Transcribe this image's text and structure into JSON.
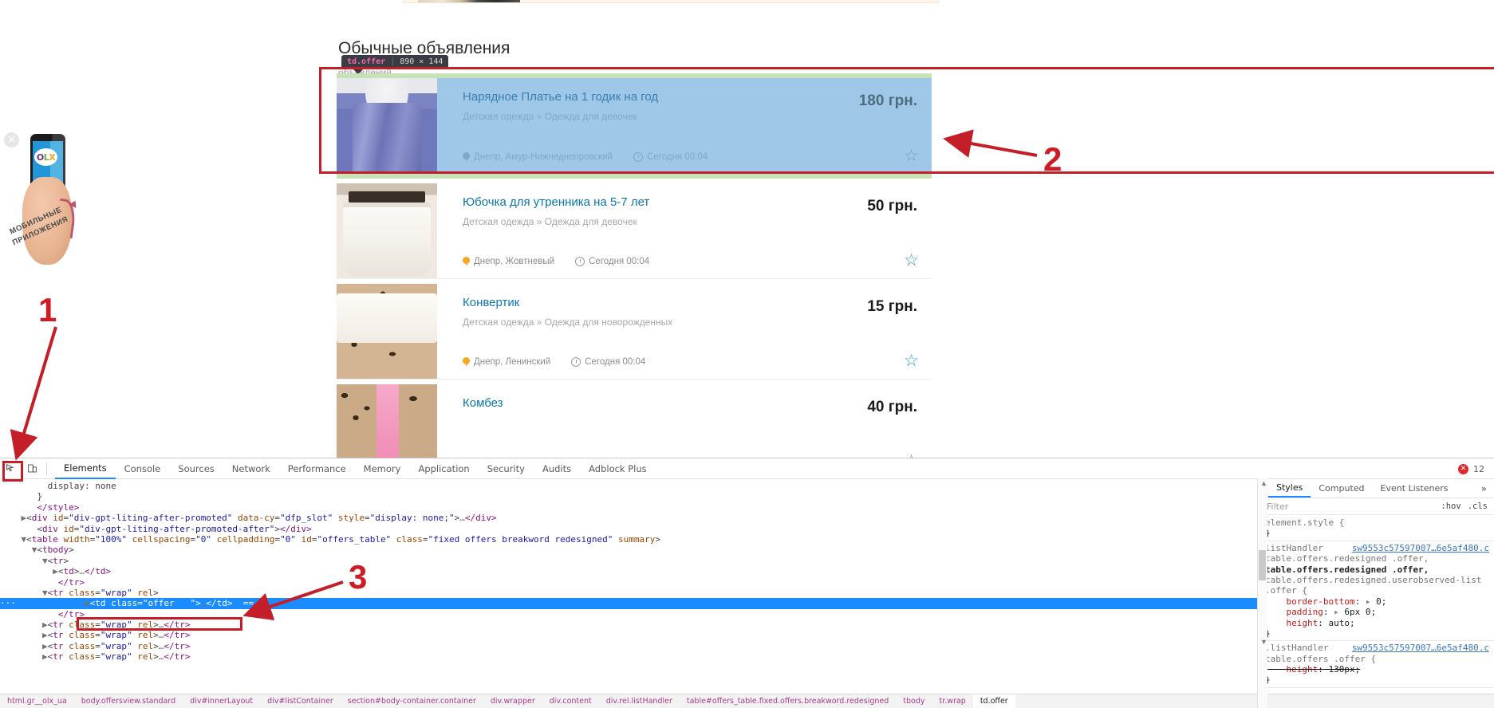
{
  "page": {
    "section_title": "Обычные объявления",
    "section_subtitle": "объявлений",
    "inspect_tooltip": {
      "selector": "td.offer",
      "dimensions": "890 × 144"
    },
    "ad": {
      "close_label": "×",
      "logo_o": "O",
      "logo_l": "L",
      "logo_x": "X",
      "caption": "МОБИЛЬНЫЕ ПРИЛОЖЕНИЯ"
    },
    "listings": [
      {
        "title": "Нарядное Платье на 1 годик на год",
        "category": "Детская одежда » Одежда для девочек",
        "location": "Днепр, Амур-Нижнеднепровский",
        "time": "Сегодня 00:04",
        "price": "180 грн.",
        "star": "☆",
        "highlighted": true
      },
      {
        "title": "Юбочка для утренника на 5-7 лет",
        "category": "Детская одежда » Одежда для девочек",
        "location": "Днепр, Жовтневый",
        "time": "Сегодня 00:04",
        "price": "50 грн.",
        "star": "☆",
        "highlighted": false
      },
      {
        "title": "Конвертик",
        "category": "Детская одежда » Одежда для новорожденных",
        "location": "Днепр, Ленинский",
        "time": "Сегодня 00:04",
        "price": "15 грн.",
        "star": "☆",
        "highlighted": false
      },
      {
        "title": "Комбез",
        "category": "",
        "location": "",
        "time": "",
        "price": "40 грн.",
        "star": "☆",
        "highlighted": false
      }
    ],
    "annotations": [
      {
        "label": "1"
      },
      {
        "label": "2"
      },
      {
        "label": "3"
      }
    ]
  },
  "devtools": {
    "tabs": [
      "Elements",
      "Console",
      "Sources",
      "Network",
      "Performance",
      "Memory",
      "Application",
      "Security",
      "Audits",
      "Adblock Plus"
    ],
    "active_tab": "Elements",
    "error_count": "12",
    "error_glyph": "✕",
    "inspect_icon": "⬚",
    "device_icon": "▯",
    "tree": [
      {
        "indent": 4,
        "parts": [
          {
            "t": "display: none",
            "c": "punc"
          }
        ]
      },
      {
        "indent": 3,
        "parts": [
          {
            "t": "}",
            "c": "punc"
          }
        ]
      },
      {
        "indent": 3,
        "parts": [
          {
            "t": "</style>",
            "c": "tag"
          }
        ]
      },
      {
        "indent": 2,
        "arrow": "▶",
        "parts": [
          {
            "t": "<",
            "c": "punc"
          },
          {
            "t": "div",
            "c": "tag"
          },
          {
            "t": " id",
            "c": "attr"
          },
          {
            "t": "=",
            "c": "punc"
          },
          {
            "t": "\"div-gpt-liting-after-promoted\"",
            "c": "val"
          },
          {
            "t": " data-cy",
            "c": "attr"
          },
          {
            "t": "=",
            "c": "punc"
          },
          {
            "t": "\"dfp_slot\"",
            "c": "val"
          },
          {
            "t": " style",
            "c": "attr"
          },
          {
            "t": "=",
            "c": "punc"
          },
          {
            "t": "\"display: none;\"",
            "c": "val"
          },
          {
            "t": ">",
            "c": "punc"
          },
          {
            "t": "…",
            "c": "ellip"
          },
          {
            "t": "</div>",
            "c": "tag"
          }
        ]
      },
      {
        "indent": 3,
        "parts": [
          {
            "t": "<",
            "c": "punc"
          },
          {
            "t": "div",
            "c": "tag"
          },
          {
            "t": " id",
            "c": "attr"
          },
          {
            "t": "=",
            "c": "punc"
          },
          {
            "t": "\"div-gpt-liting-after-promoted-after\"",
            "c": "val"
          },
          {
            "t": ">",
            "c": "punc"
          },
          {
            "t": "</div>",
            "c": "tag"
          }
        ]
      },
      {
        "indent": 2,
        "arrow": "▼",
        "parts": [
          {
            "t": "<",
            "c": "punc"
          },
          {
            "t": "table",
            "c": "tag"
          },
          {
            "t": " width",
            "c": "attr"
          },
          {
            "t": "=",
            "c": "punc"
          },
          {
            "t": "\"100%\"",
            "c": "val"
          },
          {
            "t": " cellspacing",
            "c": "attr"
          },
          {
            "t": "=",
            "c": "punc"
          },
          {
            "t": "\"0\"",
            "c": "val"
          },
          {
            "t": " cellpadding",
            "c": "attr"
          },
          {
            "t": "=",
            "c": "punc"
          },
          {
            "t": "\"0\"",
            "c": "val"
          },
          {
            "t": " id",
            "c": "attr"
          },
          {
            "t": "=",
            "c": "punc"
          },
          {
            "t": "\"offers_table\"",
            "c": "val"
          },
          {
            "t": " class",
            "c": "attr"
          },
          {
            "t": "=",
            "c": "punc"
          },
          {
            "t": "\"fixed offers breakword redesigned\"",
            "c": "val"
          },
          {
            "t": " summary",
            "c": "attr"
          },
          {
            "t": ">",
            "c": "punc"
          }
        ]
      },
      {
        "indent": 3,
        "arrow": "▼",
        "parts": [
          {
            "t": "<",
            "c": "punc"
          },
          {
            "t": "tbody",
            "c": "tag"
          },
          {
            "t": ">",
            "c": "punc"
          }
        ]
      },
      {
        "indent": 4,
        "arrow": "▼",
        "parts": [
          {
            "t": "<",
            "c": "punc"
          },
          {
            "t": "tr",
            "c": "tag"
          },
          {
            "t": ">",
            "c": "punc"
          }
        ]
      },
      {
        "indent": 5,
        "arrow": "▶",
        "parts": [
          {
            "t": "<",
            "c": "punc"
          },
          {
            "t": "td",
            "c": "tag"
          },
          {
            "t": ">",
            "c": "punc"
          },
          {
            "t": "…",
            "c": "ellip"
          },
          {
            "t": "</td>",
            "c": "tag"
          }
        ]
      },
      {
        "indent": 5,
        "parts": [
          {
            "t": "</tr>",
            "c": "tag"
          }
        ]
      },
      {
        "indent": 4,
        "arrow": "▼",
        "parts": [
          {
            "t": "<",
            "c": "punc"
          },
          {
            "t": "tr",
            "c": "tag"
          },
          {
            "t": " class",
            "c": "attr"
          },
          {
            "t": "=",
            "c": "punc"
          },
          {
            "t": "\"wrap\"",
            "c": "val"
          },
          {
            "t": " rel",
            "c": "attr"
          },
          {
            "t": ">",
            "c": "punc"
          }
        ]
      },
      {
        "indent": 5,
        "selected": true,
        "arrow": "▶",
        "parts": [
          {
            "t": "<",
            "c": "punc"
          },
          {
            "t": "td",
            "c": "tag"
          },
          {
            "t": " class",
            "c": "attr"
          },
          {
            "t": "=",
            "c": "punc"
          },
          {
            "t": "\"offer   \"",
            "c": "val"
          },
          {
            "t": ">",
            "c": "punc"
          },
          {
            "t": "…",
            "c": "ellip"
          },
          {
            "t": "</td>",
            "c": "tag"
          },
          {
            "t": "  == ",
            "c": "punc"
          },
          {
            "t": "$0",
            "c": "dollar"
          }
        ]
      },
      {
        "indent": 5,
        "parts": [
          {
            "t": "</tr>",
            "c": "tag"
          }
        ]
      },
      {
        "indent": 4,
        "arrow": "▶",
        "parts": [
          {
            "t": "<",
            "c": "punc"
          },
          {
            "t": "tr",
            "c": "tag"
          },
          {
            "t": " class",
            "c": "attr"
          },
          {
            "t": "=",
            "c": "punc"
          },
          {
            "t": "\"wrap\"",
            "c": "val"
          },
          {
            "t": " rel",
            "c": "attr"
          },
          {
            "t": ">",
            "c": "punc"
          },
          {
            "t": "…",
            "c": "ellip"
          },
          {
            "t": "</tr>",
            "c": "tag"
          }
        ]
      },
      {
        "indent": 4,
        "arrow": "▶",
        "parts": [
          {
            "t": "<",
            "c": "punc"
          },
          {
            "t": "tr",
            "c": "tag"
          },
          {
            "t": " class",
            "c": "attr"
          },
          {
            "t": "=",
            "c": "punc"
          },
          {
            "t": "\"wrap\"",
            "c": "val"
          },
          {
            "t": " rel",
            "c": "attr"
          },
          {
            "t": ">",
            "c": "punc"
          },
          {
            "t": "…",
            "c": "ellip"
          },
          {
            "t": "</tr>",
            "c": "tag"
          }
        ]
      },
      {
        "indent": 4,
        "arrow": "▶",
        "parts": [
          {
            "t": "<",
            "c": "punc"
          },
          {
            "t": "tr",
            "c": "tag"
          },
          {
            "t": " class",
            "c": "attr"
          },
          {
            "t": "=",
            "c": "punc"
          },
          {
            "t": "\"wrap\"",
            "c": "val"
          },
          {
            "t": " rel",
            "c": "attr"
          },
          {
            "t": ">",
            "c": "punc"
          },
          {
            "t": "…",
            "c": "ellip"
          },
          {
            "t": "</tr>",
            "c": "tag"
          }
        ]
      },
      {
        "indent": 4,
        "arrow": "▶",
        "parts": [
          {
            "t": "<",
            "c": "punc"
          },
          {
            "t": "tr",
            "c": "tag"
          },
          {
            "t": " class",
            "c": "attr"
          },
          {
            "t": "=",
            "c": "punc"
          },
          {
            "t": "\"wrap\"",
            "c": "val"
          },
          {
            "t": " rel",
            "c": "attr"
          },
          {
            "t": ">",
            "c": "punc"
          },
          {
            "t": "…",
            "c": "ellip"
          },
          {
            "t": "</tr>",
            "c": "tag"
          }
        ]
      }
    ],
    "styles": {
      "tabs": [
        "Styles",
        "Computed",
        "Event Listeners"
      ],
      "active_tab": "Styles",
      "more_glyph": "»",
      "filter_placeholder": "Filter",
      "toggle_hov": ":hov",
      "toggle_cls": ".cls",
      "rules": [
        {
          "selectors": [
            {
              "text": "element.style {",
              "bold": false
            }
          ],
          "declarations": [],
          "close": "}",
          "origin": ""
        },
        {
          "origin_label": "listHandler",
          "origin": "sw9553c57597007…6e5af480.c",
          "selectors": [
            {
              "text": "table.offers.redesigned .offer,",
              "bold": false
            },
            {
              "text": "table.offers.redesigned .offer,",
              "bold": true
            },
            {
              "text": "table.offers.redesigned.userobserved-list",
              "bold": false
            },
            {
              "text": ".offer {",
              "bold": false
            }
          ],
          "declarations": [
            {
              "name": "border-bottom",
              "value": "0;",
              "expandable": true,
              "struck": false
            },
            {
              "name": "padding",
              "value": "6px 0;",
              "expandable": true,
              "struck": false
            },
            {
              "name": "height",
              "value": "auto;",
              "expandable": false,
              "struck": false
            }
          ],
          "close": "}"
        },
        {
          "origin_label": ".listHandler",
          "origin": "sw9553c57597007…6e5af480.c",
          "selectors": [
            {
              "text": "table.offers .offer {",
              "bold": false
            }
          ],
          "declarations": [
            {
              "name": "height",
              "value": "130px;",
              "expandable": false,
              "struck": true
            }
          ],
          "close": "}"
        }
      ]
    },
    "breadcrumbs": [
      "html.gr__olx_ua",
      "body.offersview.standard",
      "div#innerLayout",
      "div#listContainer",
      "section#body-container.container",
      "div.wrapper",
      "div.content",
      "div.rel.listHandler",
      "table#offers_table.fixed.offers.breakword.redesigned",
      "tbody",
      "tr.wrap",
      "td.offer"
    ],
    "active_breadcrumb": "td.offer"
  },
  "colors": {
    "annotation_red": "#c41f28",
    "highlight_blue": "#9fc8e8",
    "highlight_green": "#c7e2b6",
    "devtools_selection": "#1a8cff",
    "link_blue": "#0b76ad"
  }
}
